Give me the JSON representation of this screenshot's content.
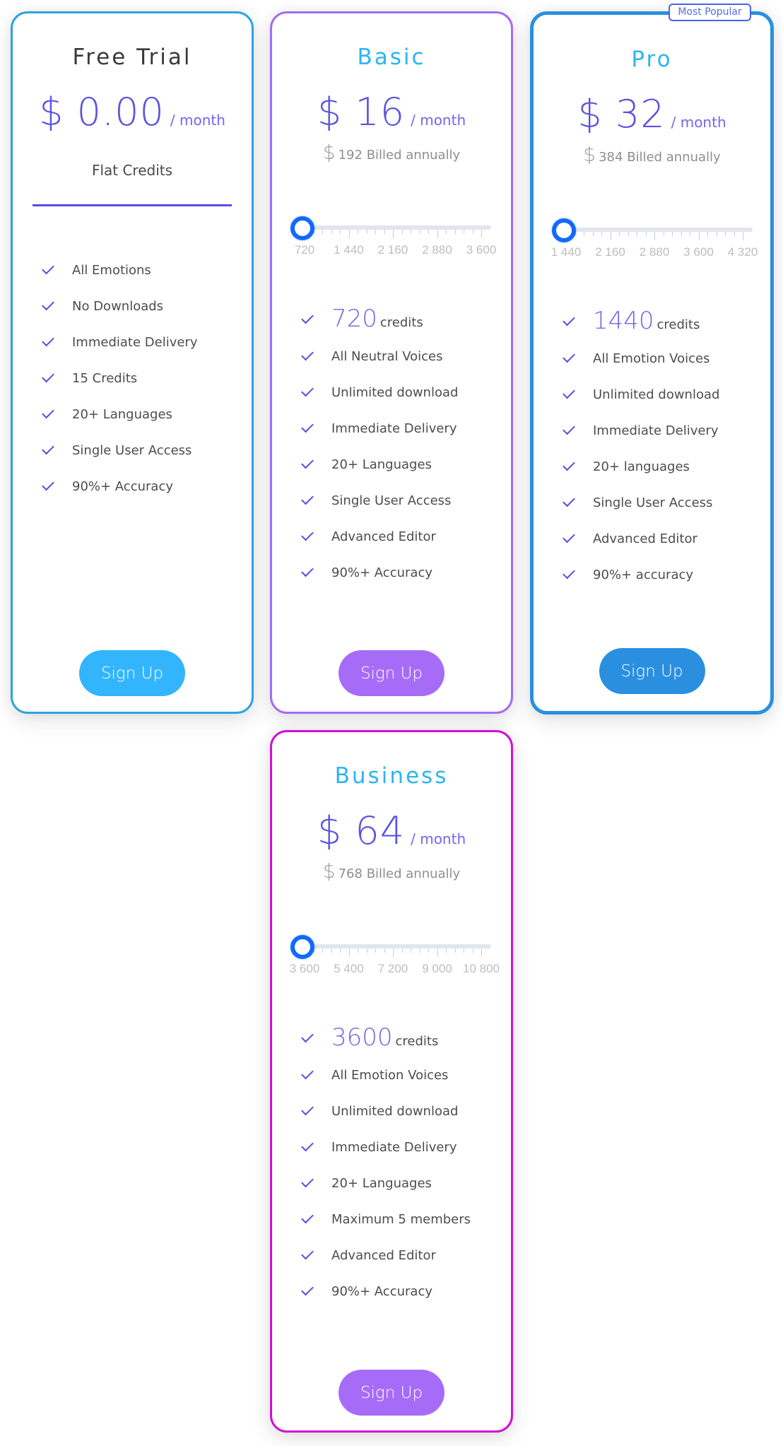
{
  "plans": {
    "free": {
      "title": "Free Trial",
      "price": "$ 0.00",
      "per": "/ month",
      "subtitle": "Flat Credits",
      "features": [
        "All Emotions",
        "No Downloads",
        "Immediate Delivery",
        "15 Credits",
        "20+ Languages",
        "Single User Access",
        "90%+ Accuracy"
      ],
      "button": "Sign Up",
      "border_color": "#2ea3e0",
      "button_color": "#32b5fc"
    },
    "basic": {
      "title": "Basic",
      "price": "$ 16",
      "per": "/ month",
      "billed_currency": "$",
      "billed_text": "192 Billed annually",
      "slider": {
        "labels": [
          "720",
          "1 440",
          "2 160",
          "2 880",
          "3 600"
        ],
        "value": 720,
        "min": 720,
        "max": 3600
      },
      "credits_value": "720",
      "credits_label": "credits",
      "features": [
        "All Neutral Voices",
        "Unlimited download",
        "Immediate Delivery",
        "20+ Languages",
        "Single User Access",
        "Advanced Editor",
        "90%+ Accuracy"
      ],
      "button": "Sign Up",
      "border_color": "#a46bf5",
      "button_color": "#a66cf8"
    },
    "pro": {
      "badge": "Most Popular",
      "title": "Pro",
      "price": "$ 32",
      "per": "/ month",
      "billed_currency": "$",
      "billed_text": "384 Billed annually",
      "slider": {
        "labels": [
          "1 440",
          "2 160",
          "2 880",
          "3 600",
          "4 320"
        ],
        "value": 1440,
        "min": 1440,
        "max": 4320
      },
      "credits_value": "1440",
      "credits_label": "credits",
      "features": [
        "All Emotion Voices",
        "Unlimited download",
        "Immediate Delivery",
        "20+ languages",
        "Single User Access",
        "Advanced Editor",
        "90%+ accuracy"
      ],
      "button": "Sign Up",
      "border_color": "#2b8fe0",
      "button_color": "#2b8fe0"
    },
    "business": {
      "title": "Business",
      "price": "$ 64",
      "per": "/ month",
      "billed_currency": "$",
      "billed_text": "768 Billed annually",
      "slider": {
        "labels": [
          "3 600",
          "5 400",
          "7 200",
          "9 000",
          "10 800"
        ],
        "value": 3600,
        "min": 3600,
        "max": 10800
      },
      "credits_value": "3600",
      "credits_label": "credits",
      "features": [
        "All Emotion Voices",
        "Unlimited download",
        "Immediate Delivery",
        "20+ Languages",
        "Maximum 5 members",
        "Advanced Editor",
        "90%+ Accuracy"
      ],
      "button": "Sign Up",
      "border_color": "#d10fd6",
      "button_color": "#a66cf8"
    }
  },
  "icons": {
    "feature_check": "check-icon",
    "slider_thumb": "slider-thumb"
  }
}
